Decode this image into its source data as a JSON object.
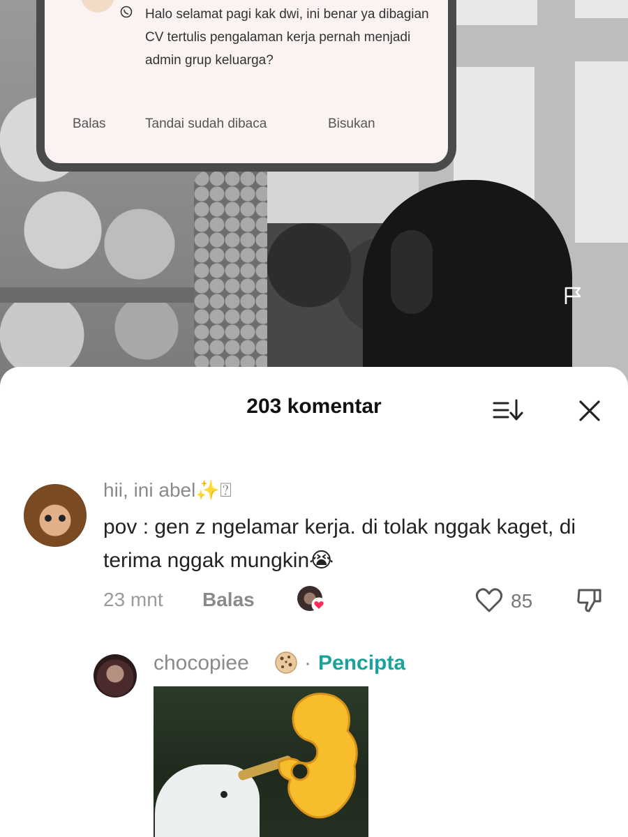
{
  "notification": {
    "message": "Halo selamat pagi kak dwi, ini benar ya dibagian CV tertulis pengalaman kerja pernah menjadi admin grup keluarga?",
    "app_icon": "whatsapp-icon",
    "actions": [
      "Balas",
      "Tandai sudah dibaca",
      "Bisukan"
    ]
  },
  "comments_panel": {
    "title": "203 komentar",
    "sort_icon": "sort-icon",
    "close_icon": "close-icon"
  },
  "comments": [
    {
      "username": "hii, ini abel✨⍰",
      "text": "pov : gen z ngelamar kerja. di tolak nggak kaget, di terima nggak mungkin😭",
      "time": "23 mnt",
      "reply_label": "Balas",
      "likes": "85"
    },
    {
      "username": "chocopiee",
      "separator": "·",
      "badge": "Pencipta"
    }
  ],
  "colors": {
    "creator_badge": "#1aa39a",
    "heart_badge": "#ff2d55"
  }
}
